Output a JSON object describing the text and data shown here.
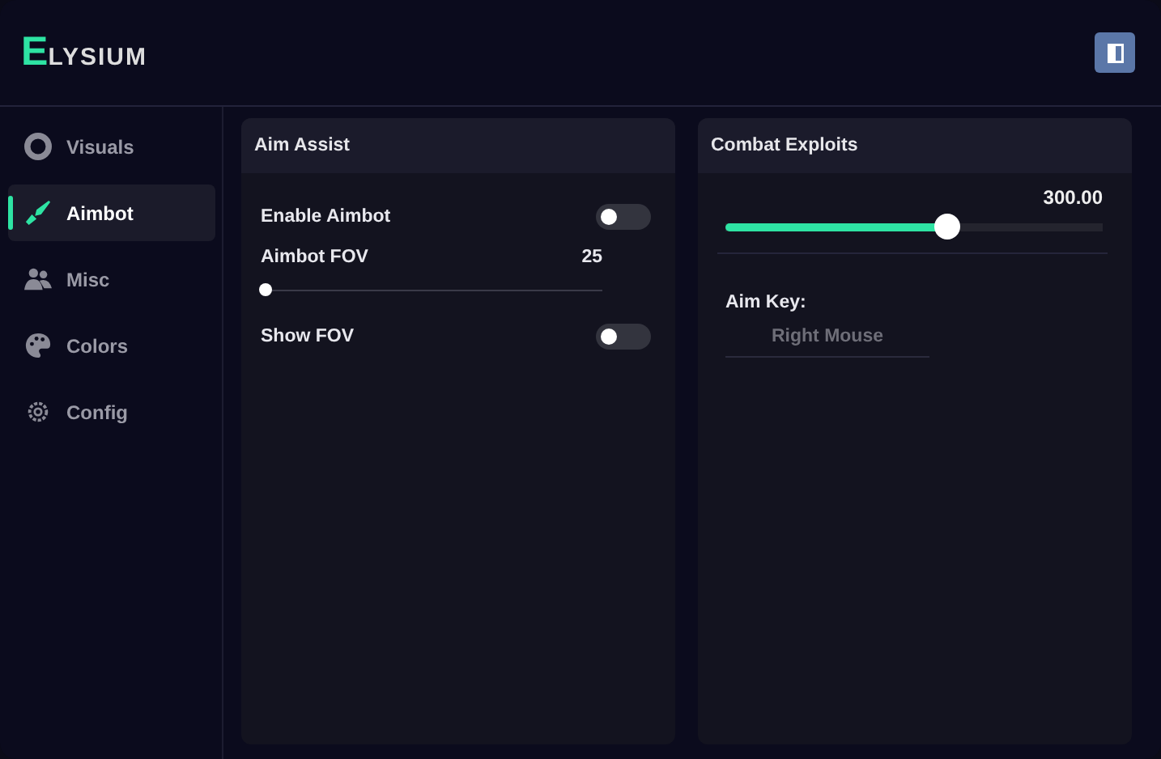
{
  "logo": {
    "initial": "E",
    "rest": "LYSIUM"
  },
  "sidebar": {
    "items": [
      {
        "label": "Visuals",
        "kind": "ring",
        "selected": false
      },
      {
        "label": "Aimbot",
        "kind": "sword",
        "selected": true
      },
      {
        "label": "Misc",
        "kind": "people",
        "selected": false
      },
      {
        "label": "Colors",
        "kind": "palette",
        "selected": false
      },
      {
        "label": "Config",
        "kind": "gear",
        "selected": false
      }
    ]
  },
  "panels": [
    {
      "title": "Aim Assist",
      "controls": [
        {
          "kind": "toggle",
          "label": "Enable Aimbot",
          "on": false
        },
        {
          "kind": "slider",
          "label": "Aimbot FOV",
          "reading": "25",
          "level": 0
        },
        {
          "kind": "toggle",
          "label": "Show FOV",
          "on": false
        }
      ]
    },
    {
      "title": "Combat Exploits",
      "controls": [
        {
          "kind": "bigslider",
          "reading": "300.00",
          "level": 0.59
        },
        {
          "kind": "keybind",
          "label": "Aim Key:",
          "value": "Right Mouse"
        }
      ]
    }
  ]
}
